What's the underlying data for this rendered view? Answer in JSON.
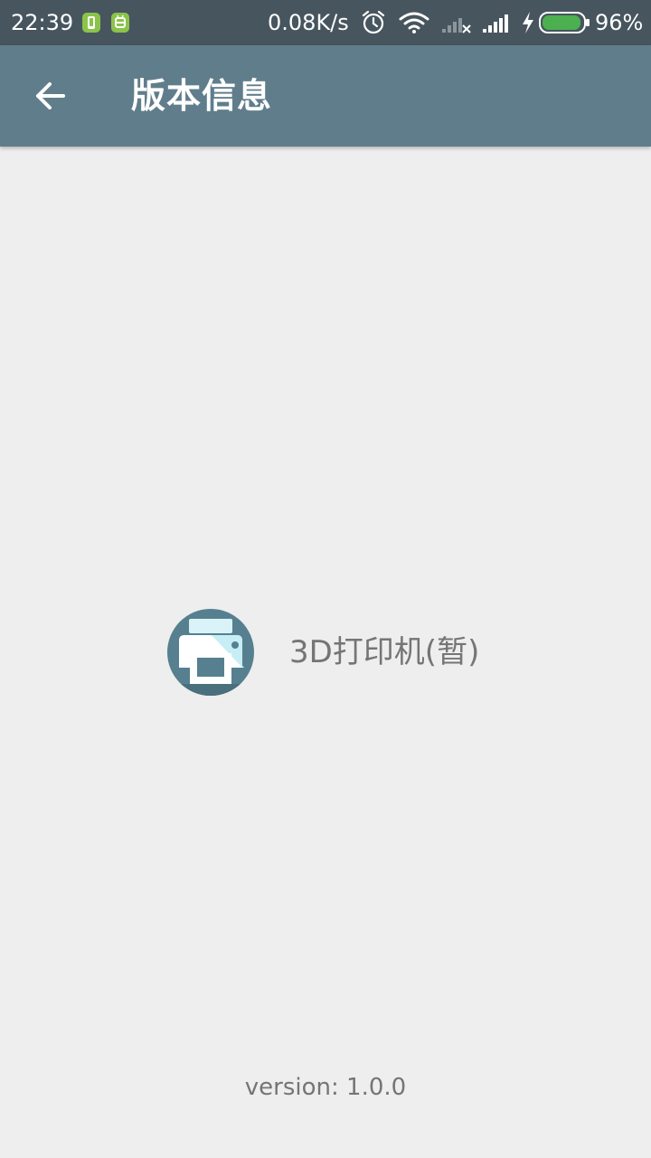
{
  "status_bar": {
    "time": "22:39",
    "net_speed": "0.08K/s",
    "battery_percent": "96%",
    "battery_level": 0.96,
    "icons": [
      "app-notification-icon",
      "android-debug-icon",
      "alarm-icon",
      "wifi-icon",
      "no-signal-icon",
      "signal-icon",
      "charging-icon",
      "battery-icon"
    ]
  },
  "appbar": {
    "title": "版本信息",
    "back_icon": "arrow-back-icon"
  },
  "app": {
    "name": "3D打印机(暂)",
    "logo_icon": "printer-icon"
  },
  "version": {
    "text": "version: 1.0.0"
  },
  "colors": {
    "status_bar": "#47555e",
    "app_bar": "#607d8b",
    "background": "#eeeeee",
    "text_secondary": "#757575",
    "battery_fill": "#4caf50"
  }
}
